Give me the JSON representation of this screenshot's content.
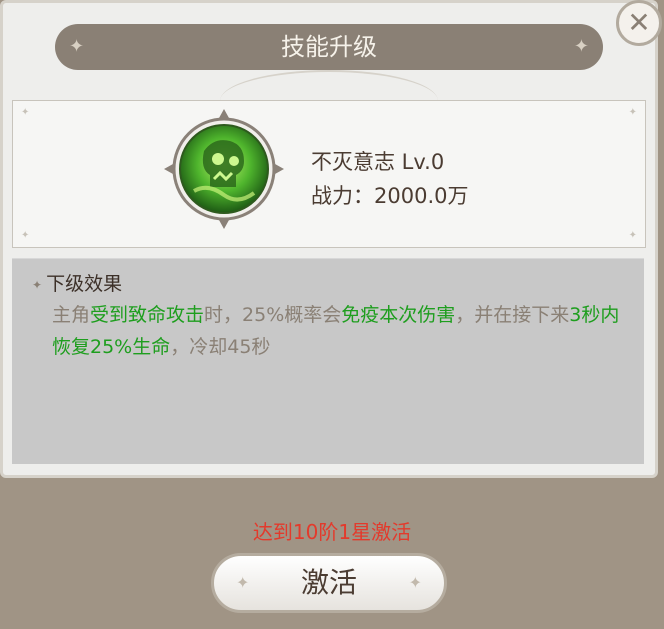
{
  "dialog": {
    "title": "技能升级",
    "close_icon": "close-icon"
  },
  "skill": {
    "name_level": "不灭意志 Lv.0",
    "power": "战力：2000.0万",
    "icon": "green-skull-skill-icon",
    "icon_color": "#3fa02a"
  },
  "effect": {
    "heading": "下级效果",
    "segments": [
      {
        "text": "主角",
        "highlight": false
      },
      {
        "text": "受到致命攻击",
        "highlight": true
      },
      {
        "text": "时，25%概率会",
        "highlight": false
      },
      {
        "text": "免疫本次伤害",
        "highlight": true
      },
      {
        "text": "，并在接下来",
        "highlight": false
      },
      {
        "text": "3秒内恢复25%生命",
        "highlight": true
      },
      {
        "text": "，冷却45秒",
        "highlight": false
      }
    ],
    "highlight_color": "#1e9e1e"
  },
  "activation": {
    "requirement": "达到10阶1星激活",
    "button_label": "激活",
    "requirement_color": "#e33a2c"
  }
}
